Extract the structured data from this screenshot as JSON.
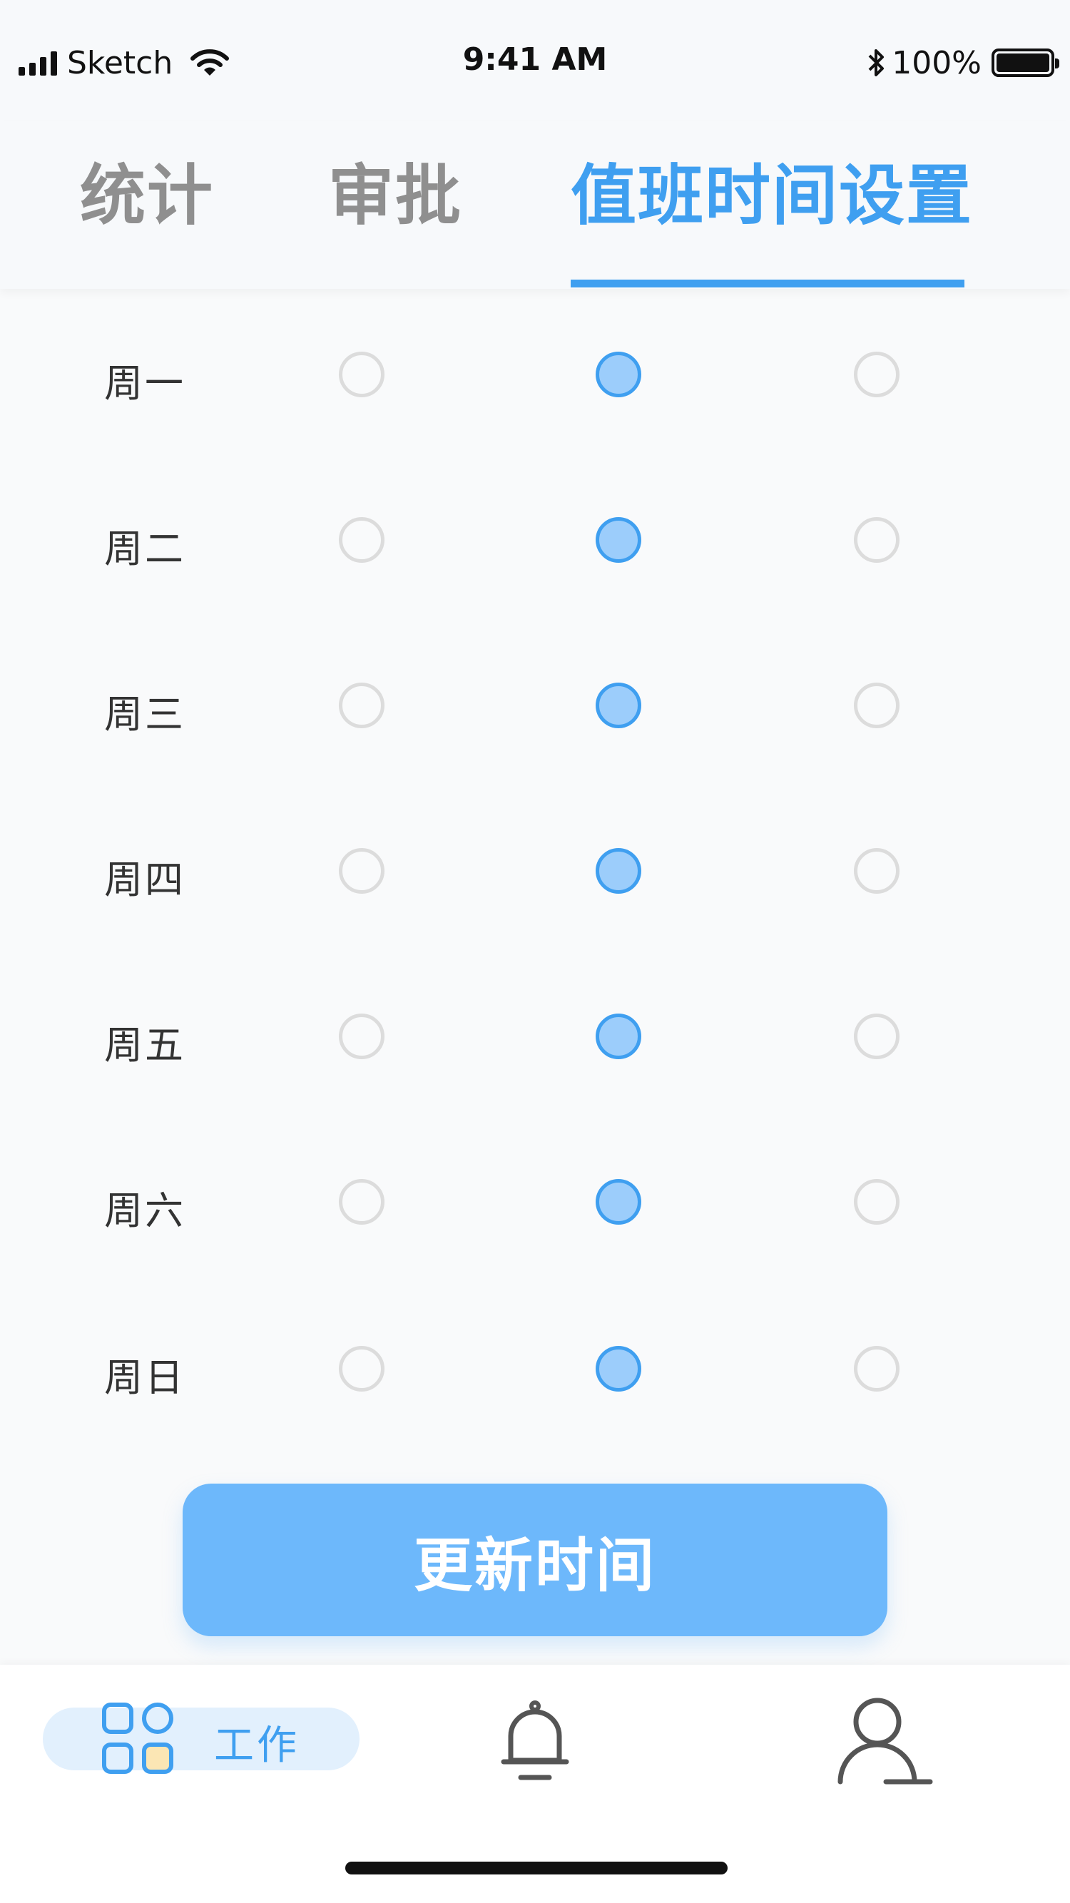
{
  "status_bar": {
    "carrier": "Sketch",
    "time": "9:41 AM",
    "battery": "100%"
  },
  "tabs": [
    {
      "label": "统计",
      "active": false
    },
    {
      "label": "审批",
      "active": false
    },
    {
      "label": "值班时间设置",
      "active": true
    }
  ],
  "schedule": [
    {
      "day": "周一",
      "selected": 1
    },
    {
      "day": "周二",
      "selected": 1
    },
    {
      "day": "周三",
      "selected": 1
    },
    {
      "day": "周四",
      "selected": 1
    },
    {
      "day": "周五",
      "selected": 1
    },
    {
      "day": "周六",
      "selected": 1
    },
    {
      "day": "周日",
      "selected": 1
    }
  ],
  "update_button": "更新时间",
  "bottom_nav": {
    "work_label": "工作",
    "icons": [
      "grid-apps-icon",
      "bell-icon",
      "user-icon"
    ]
  },
  "colors": {
    "accent": "#3f9ff0",
    "radio_fill": "#9ccdfb",
    "button": "#6db8fb",
    "inactive": "#8f8f8f"
  }
}
